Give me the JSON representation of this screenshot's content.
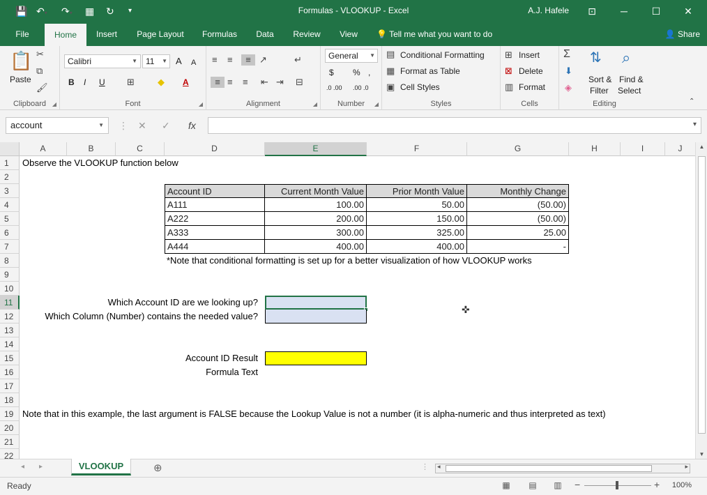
{
  "window": {
    "title": "Formulas - VLOOKUP  -  Excel",
    "user": "A.J. Hafele",
    "minimize_icon": "minimize-icon",
    "restore_icon": "restore-icon",
    "close_icon": "close-icon"
  },
  "ribbon_tabs": [
    "File",
    "Home",
    "Insert",
    "Page Layout",
    "Formulas",
    "Data",
    "Review",
    "View"
  ],
  "active_tab": "Home",
  "tell_me": "Tell me what you want to do",
  "share": "Share",
  "ribbon": {
    "clipboard": {
      "label": "Clipboard",
      "paste": "Paste"
    },
    "font": {
      "label": "Font",
      "name": "Calibri",
      "size": "11",
      "bold": "B",
      "italic": "I",
      "underline": "U",
      "grow": "A",
      "shrink": "A"
    },
    "alignment": {
      "label": "Alignment"
    },
    "number": {
      "label": "Number",
      "format": "General",
      "currency": "$",
      "percent": "%",
      "comma": ",",
      "inc": ".0 .00",
      "dec": ".00 .0"
    },
    "styles": {
      "label": "Styles",
      "conditional": "Conditional Formatting",
      "format_table": "Format as Table",
      "cell_styles": "Cell Styles"
    },
    "cells": {
      "label": "Cells",
      "insert": "Insert",
      "delete": "Delete",
      "format": "Format"
    },
    "editing": {
      "label": "Editing",
      "sort_top": "Sort &",
      "sort_bottom": "Filter",
      "find_top": "Find &",
      "find_bottom": "Select"
    }
  },
  "formula_bar": {
    "name_box": "account",
    "cancel": "✕",
    "enter": "✓",
    "fx": "fx",
    "value": ""
  },
  "columns": [
    "A",
    "B",
    "C",
    "D",
    "E",
    "F",
    "G",
    "H",
    "I",
    "J"
  ],
  "active_column": "E",
  "rows": [
    "1",
    "2",
    "3",
    "4",
    "5",
    "6",
    "7",
    "8",
    "9",
    "10",
    "11",
    "12",
    "13",
    "14",
    "15",
    "16",
    "17",
    "18",
    "19",
    "20",
    "21",
    "22"
  ],
  "active_row": "11",
  "sheet": {
    "a1": "Observe the VLOOKUP function below",
    "table_header": [
      "Account ID",
      "Current Month Value",
      "Prior Month Value",
      "Monthly Change"
    ],
    "table_rows": [
      [
        "A111",
        "100.00",
        "50.00",
        "(50.00)"
      ],
      [
        "A222",
        "200.00",
        "150.00",
        "(50.00)"
      ],
      [
        "A333",
        "300.00",
        "325.00",
        "25.00"
      ],
      [
        "A444",
        "400.00",
        "400.00",
        "-"
      ]
    ],
    "note8": "*Note that conditional formatting is set up for a better visualization of how VLOOKUP works",
    "q11": "Which Account ID are we looking up?",
    "q12": "Which Column (Number) contains the needed value?",
    "r15": "Account ID Result",
    "r16": "Formula Text",
    "note19": "Note that in this example, the last argument is FALSE because the Lookup Value is not a number (it is alpha-numeric and thus interpreted as text)",
    "input_fill": "#d9e1f2",
    "result_fill": "#ffff00"
  },
  "sheet_tab": "VLOOKUP",
  "status": {
    "ready": "Ready",
    "zoom": "100%"
  },
  "colors": {
    "accent": "#217346",
    "header_fill": "#d9d9d9"
  }
}
